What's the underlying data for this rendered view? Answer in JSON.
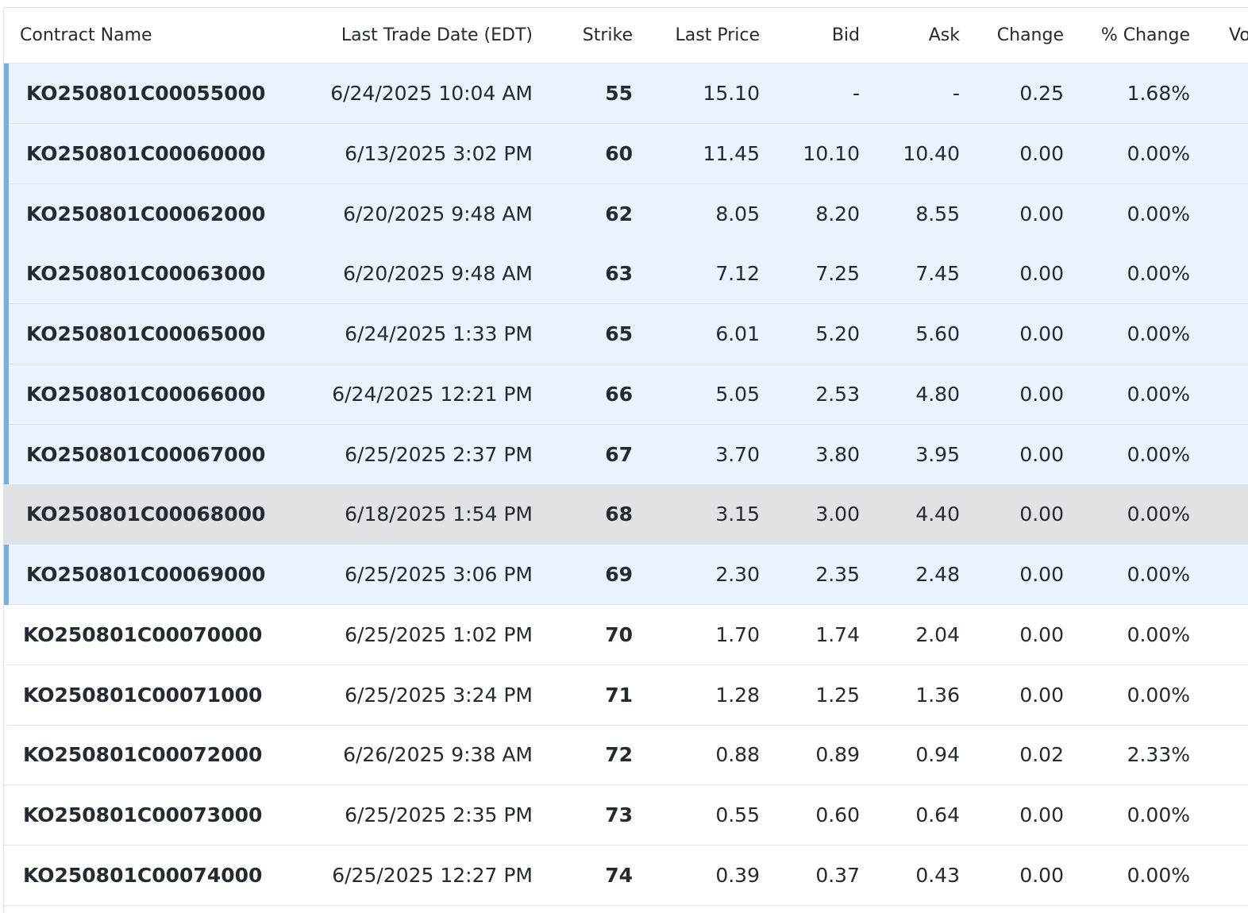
{
  "table": {
    "headers": {
      "contract_name": "Contract Name",
      "last_trade_date": "Last Trade Date (EDT)",
      "strike": "Strike",
      "last_price": "Last Price",
      "bid": "Bid",
      "ask": "Ask",
      "change": "Change",
      "pct_change": "% Change",
      "volume_partial": "Vo"
    },
    "rows": [
      {
        "contract": "KO250801C00055000",
        "date": "6/24/2025 10:04 AM",
        "strike": "55",
        "last": "15.10",
        "bid": "-",
        "ask": "-",
        "change": "0.25",
        "pct": "1.68%",
        "state": "itm"
      },
      {
        "contract": "KO250801C00060000",
        "date": "6/13/2025 3:02 PM",
        "strike": "60",
        "last": "11.45",
        "bid": "10.10",
        "ask": "10.40",
        "change": "0.00",
        "pct": "0.00%",
        "state": "itm"
      },
      {
        "contract": "KO250801C00062000",
        "date": "6/20/2025 9:48 AM",
        "strike": "62",
        "last": "8.05",
        "bid": "8.20",
        "ask": "8.55",
        "change": "0.00",
        "pct": "0.00%",
        "state": "itm"
      },
      {
        "contract": "KO250801C00063000",
        "date": "6/20/2025 9:48 AM",
        "strike": "63",
        "last": "7.12",
        "bid": "7.25",
        "ask": "7.45",
        "change": "0.00",
        "pct": "0.00%",
        "state": "itm"
      },
      {
        "contract": "KO250801C00065000",
        "date": "6/24/2025 1:33 PM",
        "strike": "65",
        "last": "6.01",
        "bid": "5.20",
        "ask": "5.60",
        "change": "0.00",
        "pct": "0.00%",
        "state": "itm"
      },
      {
        "contract": "KO250801C00066000",
        "date": "6/24/2025 12:21 PM",
        "strike": "66",
        "last": "5.05",
        "bid": "2.53",
        "ask": "4.80",
        "change": "0.00",
        "pct": "0.00%",
        "state": "itm"
      },
      {
        "contract": "KO250801C00067000",
        "date": "6/25/2025 2:37 PM",
        "strike": "67",
        "last": "3.70",
        "bid": "3.80",
        "ask": "3.95",
        "change": "0.00",
        "pct": "0.00%",
        "state": "itm"
      },
      {
        "contract": "KO250801C00068000",
        "date": "6/18/2025 1:54 PM",
        "strike": "68",
        "last": "3.15",
        "bid": "3.00",
        "ask": "4.40",
        "change": "0.00",
        "pct": "0.00%",
        "state": "hov"
      },
      {
        "contract": "KO250801C00069000",
        "date": "6/25/2025 3:06 PM",
        "strike": "69",
        "last": "2.30",
        "bid": "2.35",
        "ask": "2.48",
        "change": "0.00",
        "pct": "0.00%",
        "state": "itm"
      },
      {
        "contract": "KO250801C00070000",
        "date": "6/25/2025 1:02 PM",
        "strike": "70",
        "last": "1.70",
        "bid": "1.74",
        "ask": "2.04",
        "change": "0.00",
        "pct": "0.00%",
        "state": "otm"
      },
      {
        "contract": "KO250801C00071000",
        "date": "6/25/2025 3:24 PM",
        "strike": "71",
        "last": "1.28",
        "bid": "1.25",
        "ask": "1.36",
        "change": "0.00",
        "pct": "0.00%",
        "state": "otm"
      },
      {
        "contract": "KO250801C00072000",
        "date": "6/26/2025 9:38 AM",
        "strike": "72",
        "last": "0.88",
        "bid": "0.89",
        "ask": "0.94",
        "change": "0.02",
        "pct": "2.33%",
        "state": "otm"
      },
      {
        "contract": "KO250801C00073000",
        "date": "6/25/2025 2:35 PM",
        "strike": "73",
        "last": "0.55",
        "bid": "0.60",
        "ask": "0.64",
        "change": "0.00",
        "pct": "0.00%",
        "state": "otm"
      },
      {
        "contract": "KO250801C00074000",
        "date": "6/25/2025 12:27 PM",
        "strike": "74",
        "last": "0.39",
        "bid": "0.37",
        "ask": "0.43",
        "change": "0.00",
        "pct": "0.00%",
        "state": "otm"
      }
    ]
  },
  "colors": {
    "in_the_money_bg": "#e8f3fd",
    "in_the_money_bar": "#7aaddb",
    "hover_row_bg": "#e1e2e5",
    "text": "#232a31",
    "border": "#e0e4e9"
  }
}
